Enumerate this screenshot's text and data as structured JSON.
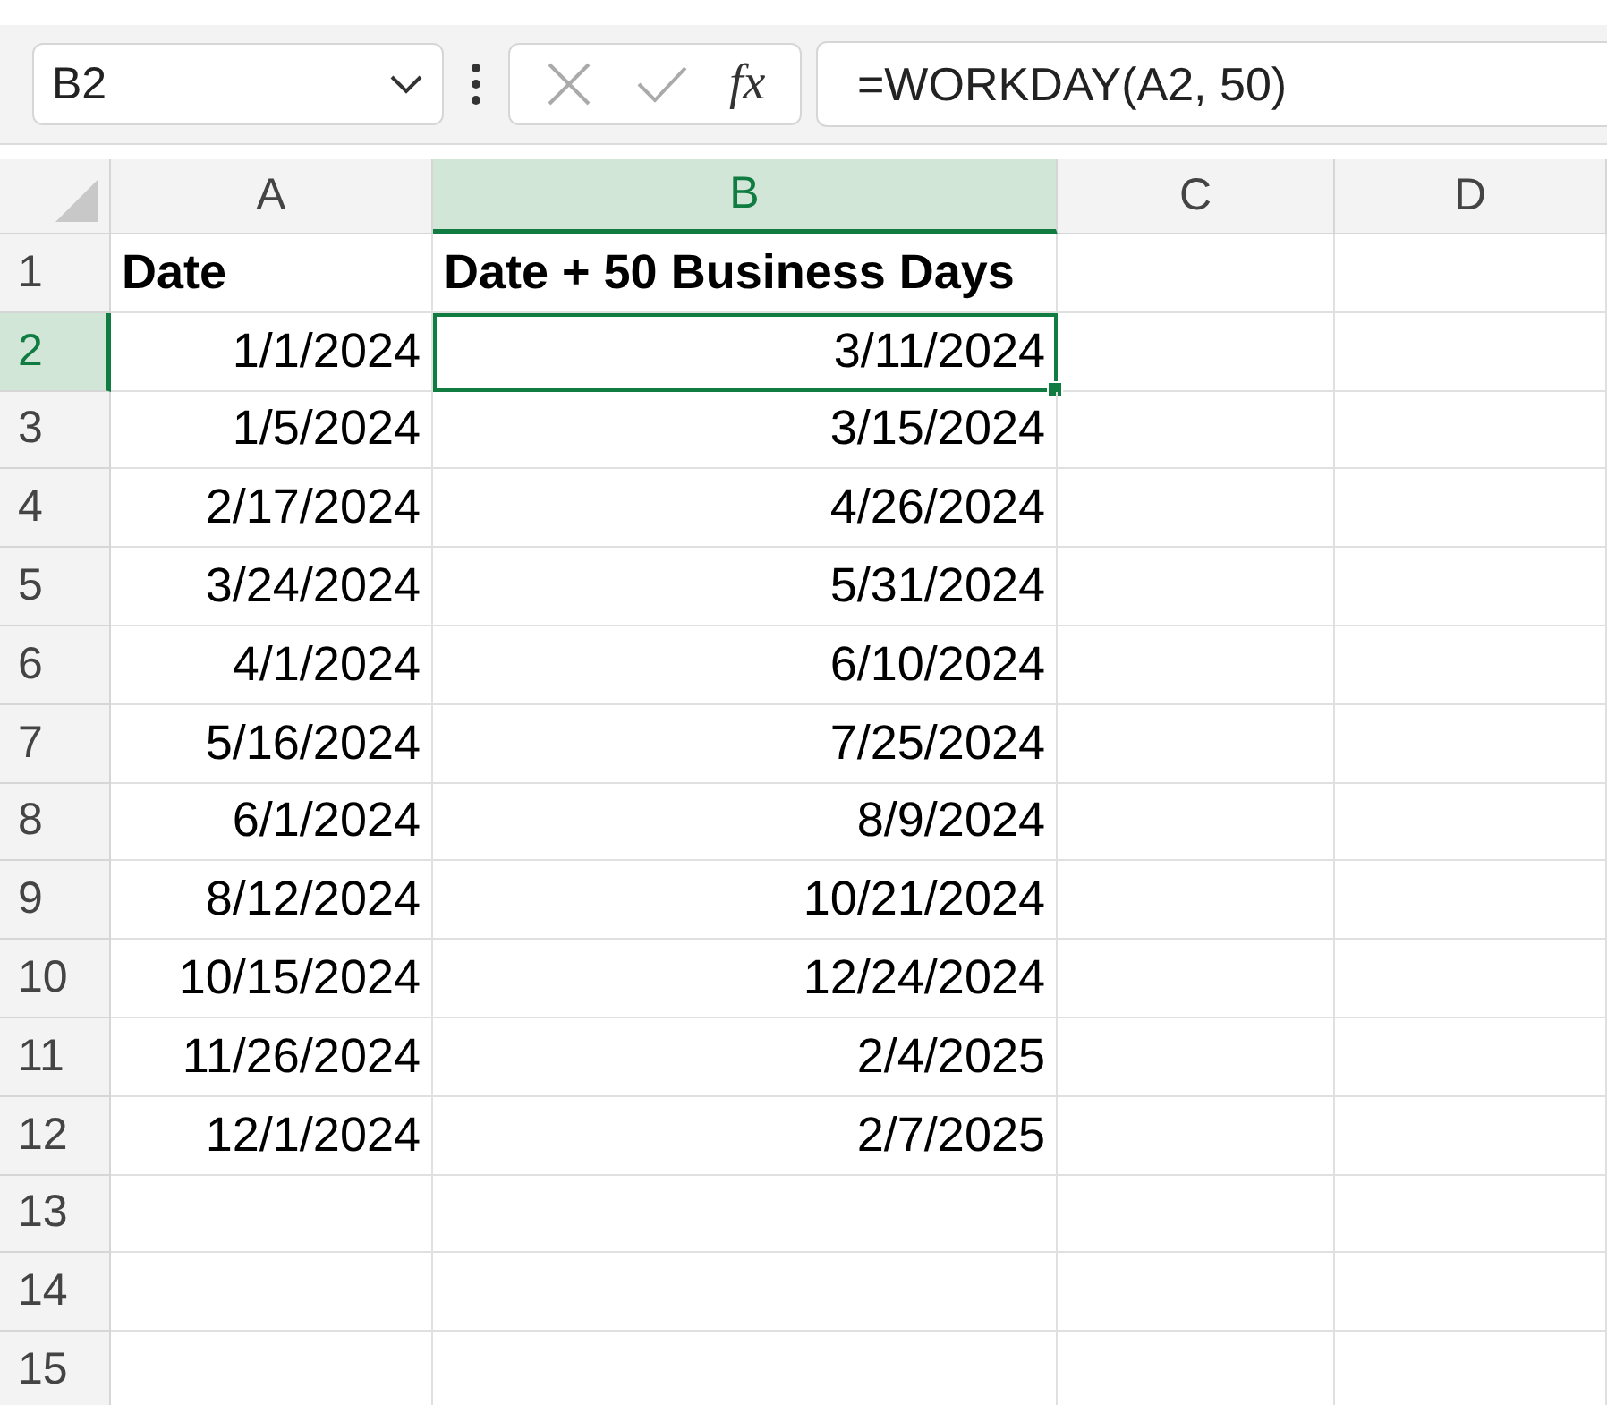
{
  "name_box": {
    "value": "B2"
  },
  "formula_bar": {
    "fx": "fx",
    "formula": "=WORKDAY(A2, 50)"
  },
  "columns": [
    {
      "label": "A",
      "selected": false
    },
    {
      "label": "B",
      "selected": true
    },
    {
      "label": "C",
      "selected": false
    },
    {
      "label": "D",
      "selected": false
    }
  ],
  "rows": [
    {
      "label": "1",
      "selected": false,
      "bold": true,
      "cells": [
        {
          "text": "Date",
          "selected": false
        },
        {
          "text": "Date + 50 Business Days",
          "selected": false
        }
      ]
    },
    {
      "label": "2",
      "selected": true,
      "bold": false,
      "cells": [
        {
          "text": "1/1/2024",
          "selected": false
        },
        {
          "text": "3/11/2024",
          "selected": true
        }
      ]
    },
    {
      "label": "3",
      "selected": false,
      "bold": false,
      "cells": [
        {
          "text": "1/5/2024",
          "selected": false
        },
        {
          "text": "3/15/2024",
          "selected": false
        }
      ]
    },
    {
      "label": "4",
      "selected": false,
      "bold": false,
      "cells": [
        {
          "text": "2/17/2024",
          "selected": false
        },
        {
          "text": "4/26/2024",
          "selected": false
        }
      ]
    },
    {
      "label": "5",
      "selected": false,
      "bold": false,
      "cells": [
        {
          "text": "3/24/2024",
          "selected": false
        },
        {
          "text": "5/31/2024",
          "selected": false
        }
      ]
    },
    {
      "label": "6",
      "selected": false,
      "bold": false,
      "cells": [
        {
          "text": "4/1/2024",
          "selected": false
        },
        {
          "text": "6/10/2024",
          "selected": false
        }
      ]
    },
    {
      "label": "7",
      "selected": false,
      "bold": false,
      "cells": [
        {
          "text": "5/16/2024",
          "selected": false
        },
        {
          "text": "7/25/2024",
          "selected": false
        }
      ]
    },
    {
      "label": "8",
      "selected": false,
      "bold": false,
      "cells": [
        {
          "text": "6/1/2024",
          "selected": false
        },
        {
          "text": "8/9/2024",
          "selected": false
        }
      ]
    },
    {
      "label": "9",
      "selected": false,
      "bold": false,
      "cells": [
        {
          "text": "8/12/2024",
          "selected": false
        },
        {
          "text": "10/21/2024",
          "selected": false
        }
      ]
    },
    {
      "label": "10",
      "selected": false,
      "bold": false,
      "cells": [
        {
          "text": "10/15/2024",
          "selected": false
        },
        {
          "text": "12/24/2024",
          "selected": false
        }
      ]
    },
    {
      "label": "11",
      "selected": false,
      "bold": false,
      "cells": [
        {
          "text": "11/26/2024",
          "selected": false
        },
        {
          "text": "2/4/2025",
          "selected": false
        }
      ]
    },
    {
      "label": "12",
      "selected": false,
      "bold": false,
      "cells": [
        {
          "text": "12/1/2024",
          "selected": false
        },
        {
          "text": "2/7/2025",
          "selected": false
        }
      ]
    },
    {
      "label": "13",
      "selected": false
    },
    {
      "label": "14",
      "selected": false
    },
    {
      "label": "15",
      "selected": false
    }
  ]
}
